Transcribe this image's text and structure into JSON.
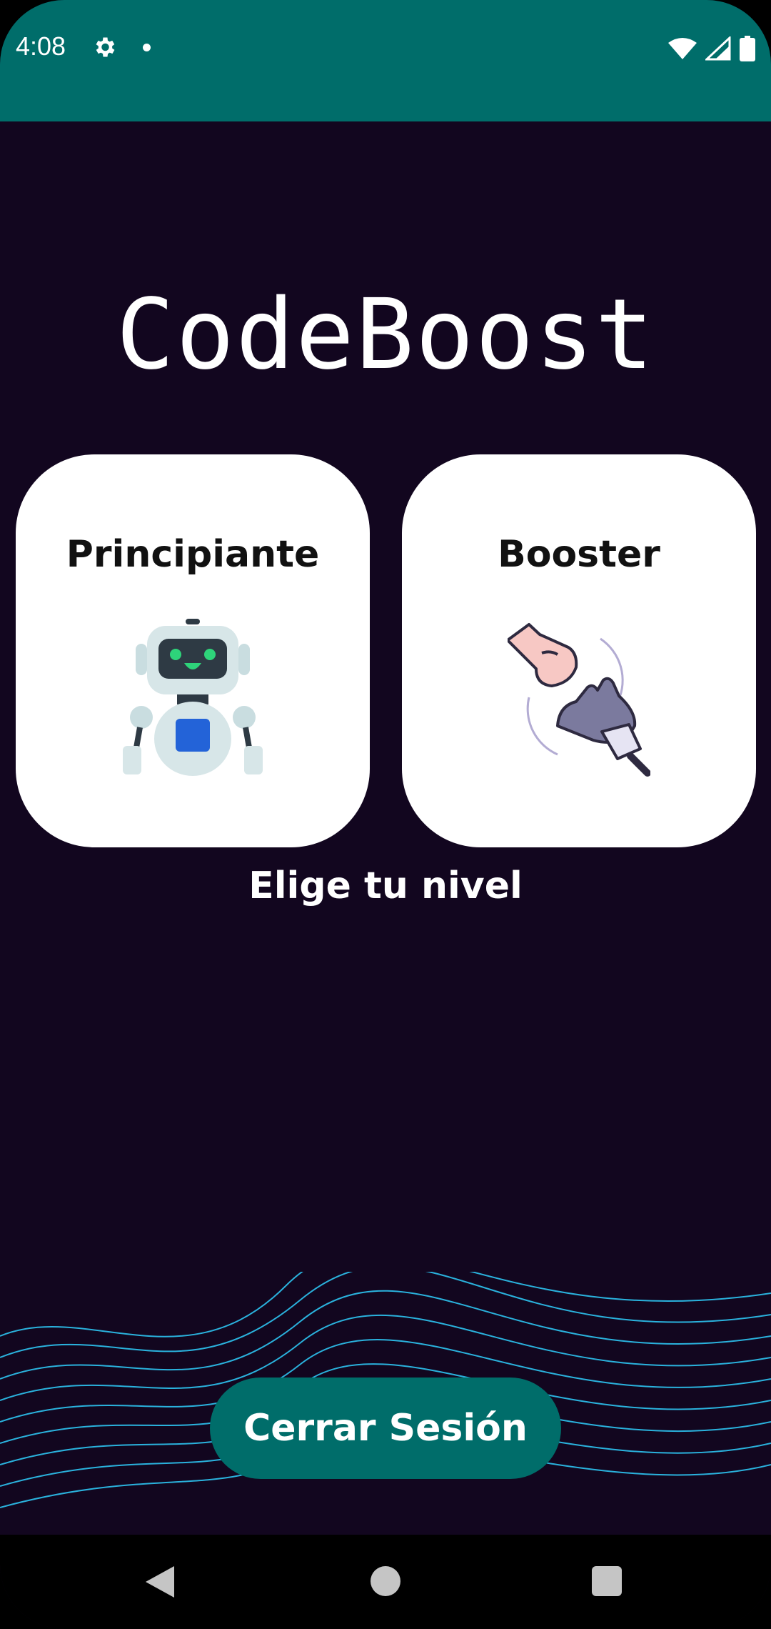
{
  "status_bar": {
    "time": "4:08",
    "icons": [
      "gear-icon",
      "notification-dot-icon",
      "wifi-icon",
      "cell-signal-icon",
      "battery-icon"
    ]
  },
  "app": {
    "title": "CodeBoost",
    "subtitle": "Elige tu nivel"
  },
  "levels": [
    {
      "label": "Principiante",
      "icon": "robot-icon"
    },
    {
      "label": "Booster",
      "icon": "human-robot-hands-icon"
    }
  ],
  "logout_label": "Cerrar Sesión",
  "nav_bar": {
    "icons": [
      "back-icon",
      "home-icon",
      "recent-apps-icon"
    ]
  },
  "colors": {
    "accent": "#006d6a",
    "background": "#12061f",
    "card": "#ffffff",
    "wave": "#2fd0ff"
  }
}
